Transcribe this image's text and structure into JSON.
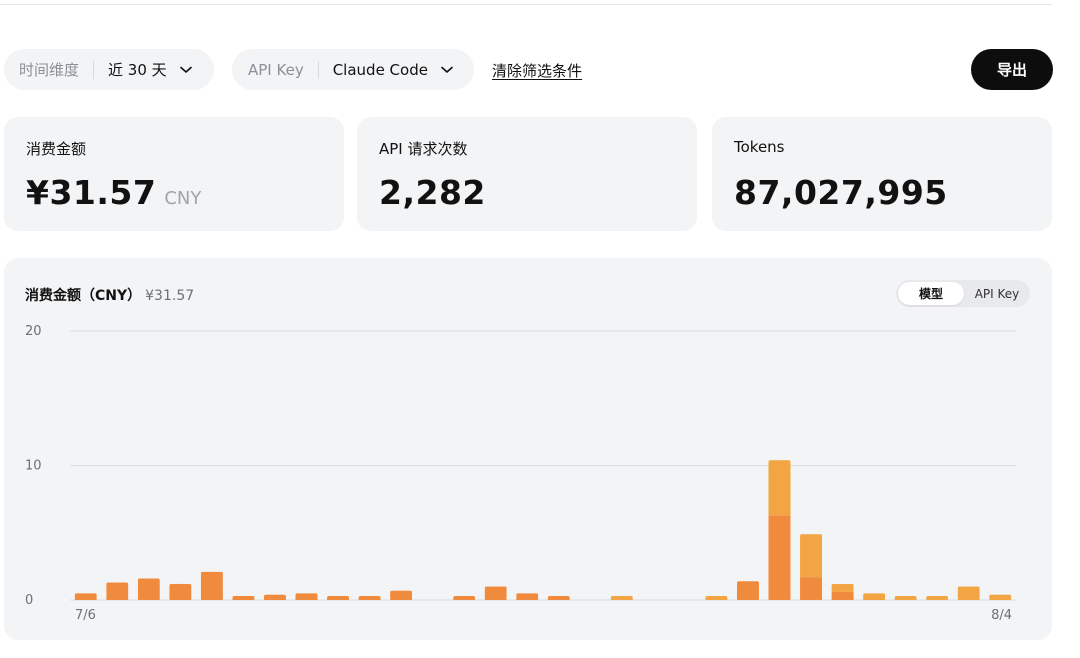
{
  "filters": {
    "time": {
      "label": "时间维度",
      "value": "近 30 天"
    },
    "api_key": {
      "label": "API Key",
      "value": "Claude Code"
    },
    "clear_label": "清除筛选条件",
    "export_label": "导出"
  },
  "stats": {
    "amount": {
      "label": "消费金额",
      "value": "¥31.57",
      "unit": "CNY"
    },
    "requests": {
      "label": "API 请求次数",
      "value": "2,282"
    },
    "tokens": {
      "label": "Tokens",
      "value": "87,027,995"
    }
  },
  "chart_panel": {
    "title": "消费金额（CNY）",
    "total": "¥31.57",
    "toggle": {
      "active": "模型",
      "inactive": "API Key"
    }
  },
  "colors": {
    "bar_primary": "#F08A3C",
    "bar_secondary": "#F3A543",
    "gridline": "#d9dce3",
    "axis_text": "#6b7079"
  },
  "chart_data": {
    "type": "bar",
    "stacked": true,
    "ylim": [
      0,
      20
    ],
    "y_ticks": [
      0,
      10,
      20
    ],
    "x_labels": {
      "first": "7/6",
      "last": "8/4"
    },
    "grid": true,
    "categories_count": 30,
    "series": [
      {
        "values": [
          0.5,
          1.3,
          1.6,
          1.2,
          2.1,
          0.3,
          0.4,
          0.5,
          0.3,
          0.3,
          0.7,
          0,
          0.3,
          1.0,
          0.5,
          0.3,
          0,
          0,
          0,
          0,
          0,
          1.4,
          6.3,
          1.7,
          0.6,
          0,
          0,
          0,
          0,
          0
        ]
      },
      {
        "values": [
          0,
          0,
          0,
          0,
          0,
          0,
          0,
          0,
          0,
          0,
          0,
          0,
          0,
          0,
          0,
          0,
          0,
          0.3,
          0,
          0,
          0.3,
          0,
          4.1,
          3.2,
          0.6,
          0.5,
          0.3,
          0.3,
          1.0,
          0.4
        ]
      }
    ]
  }
}
